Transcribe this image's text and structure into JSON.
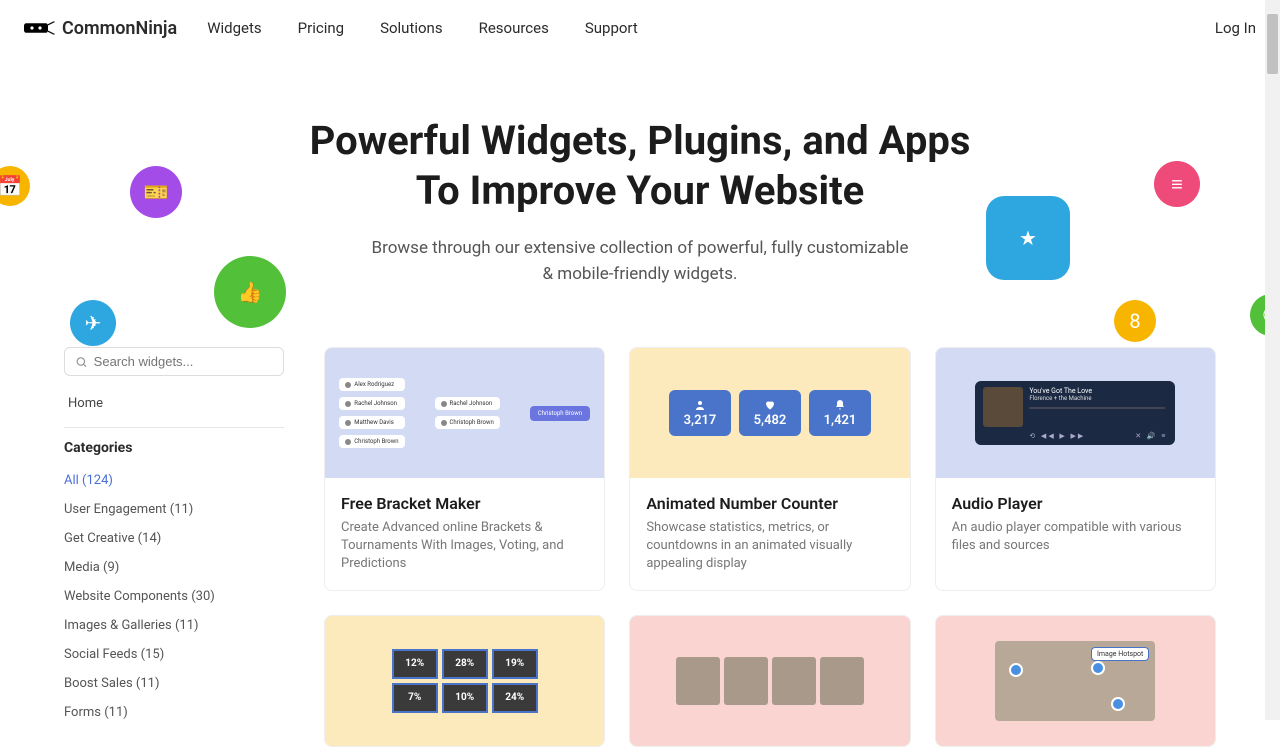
{
  "brand": "CommonNinja",
  "nav": [
    "Widgets",
    "Pricing",
    "Solutions",
    "Resources",
    "Support"
  ],
  "login": "Log In",
  "hero": {
    "title": "Powerful Widgets, Plugins, and Apps To Improve Your Website",
    "subtitle": "Browse through our extensive collection of powerful, fully customizable & mobile-friendly widgets."
  },
  "search": {
    "placeholder": "Search widgets..."
  },
  "home": "Home",
  "categoriesHeading": "Categories",
  "categories": [
    "All (124)",
    "User Engagement (11)",
    "Get Creative (14)",
    "Media (9)",
    "Website Components (30)",
    "Images & Galleries (11)",
    "Social Feeds (15)",
    "Boost Sales (11)",
    "Forms (11)"
  ],
  "cards": [
    {
      "title": "Free Bracket Maker",
      "desc": "Create Advanced online Brackets & Tournaments With Images, Voting, and Predictions",
      "bracket": {
        "col1": [
          "Alex Rodriguez",
          "Rachel Johnson",
          "Matthew Davis",
          "Christoph Brown"
        ],
        "col2": [
          "Rachel Johnson",
          "Christoph Brown"
        ],
        "winner": "Christoph Brown"
      }
    },
    {
      "title": "Animated Number Counter",
      "desc": "Showcase statistics, metrics, or countdowns in an animated visually appealing display",
      "counters": [
        "3,217",
        "5,482",
        "1,421"
      ]
    },
    {
      "title": "Audio Player",
      "desc": "An audio player compatible with various files and sources",
      "track": {
        "title": "You've Got The Love",
        "artist": "Florence + the Machine"
      }
    }
  ],
  "row2": {
    "percents": [
      "12%",
      "28%",
      "19%",
      "7%",
      "10%",
      "24%"
    ],
    "hotspotLabel": "Image Hotspot"
  }
}
